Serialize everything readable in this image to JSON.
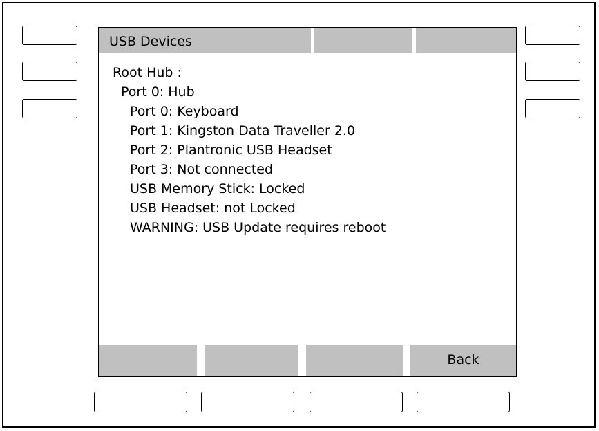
{
  "screen": {
    "title": "USB Devices",
    "lines": [
      {
        "text": "Root Hub :",
        "indent": 0
      },
      {
        "text": "Port 0: Hub",
        "indent": 1
      },
      {
        "text": "Port 0: Keyboard",
        "indent": 2
      },
      {
        "text": "Port 1: Kingston Data Traveller 2.0",
        "indent": 2
      },
      {
        "text": "Port 2: Plantronic USB Headset",
        "indent": 2
      },
      {
        "text": "Port 3: Not connected",
        "indent": 2
      },
      {
        "text": "USB Memory Stick: Locked",
        "indent": 2
      },
      {
        "text": "USB Headset: not Locked",
        "indent": 2
      },
      {
        "text": "WARNING: USB Update requires reboot",
        "indent": 2
      }
    ],
    "softkeys": [
      "",
      "",
      "",
      "Back"
    ]
  }
}
